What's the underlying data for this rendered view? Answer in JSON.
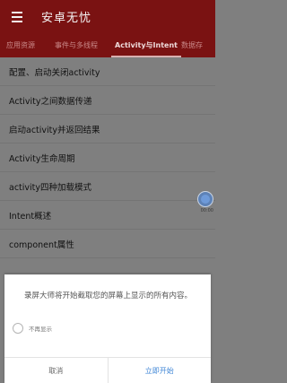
{
  "app": {
    "title": "安卓无忧"
  },
  "tabs": [
    {
      "label": "应用资源",
      "active": false
    },
    {
      "label": "事件与多线程",
      "active": false
    },
    {
      "label": "Activity与Intent",
      "active": true
    },
    {
      "label": "数据存",
      "active": false
    }
  ],
  "list": [
    "配置、启动关闭activity",
    "Activity之间数据传递",
    "启动activity并返回结果",
    "Activity生命周期",
    "activity四种加载模式",
    "Intent概述",
    "component属性"
  ],
  "float_widget": {
    "time": "00:00"
  },
  "dialog": {
    "message": "录屏大师将开始截取您的屏幕上显示的所有内容。",
    "checkbox_label": "不再显示",
    "cancel_label": "取消",
    "start_label": "立即开始"
  },
  "colors": {
    "appbar": "#7a1212",
    "accent": "#3f86d6",
    "overlay": "#7f7f7f"
  }
}
